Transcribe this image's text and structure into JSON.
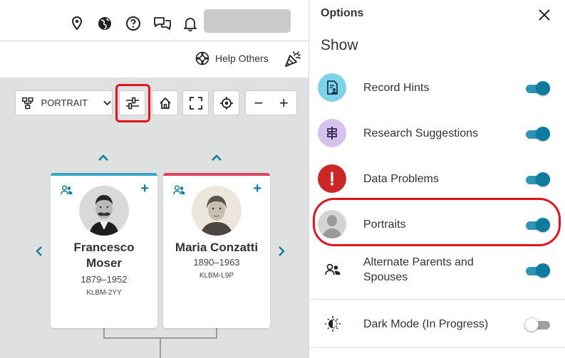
{
  "header": {
    "icons": [
      "location-pin-icon",
      "globe-icon",
      "help-circle-icon",
      "chat-icon",
      "bell-icon"
    ],
    "help_others_label": "Help Others"
  },
  "toolbar": {
    "view_label": "PORTRAIT",
    "zoom_out": "−",
    "zoom_in": "+"
  },
  "cards": [
    {
      "name_line1": "Francesco",
      "name_line2": "Moser",
      "dates": "1879–1952",
      "pid": "KLBM-2YY",
      "gender_color": "#3aa3c7"
    },
    {
      "name_line1": "Maria Conzatti",
      "name_line2": "",
      "dates": "1890–1963",
      "pid": "KLBM-L9P",
      "gender_color": "#d9455e"
    }
  ],
  "panel": {
    "title": "Options",
    "section": "Show",
    "options": [
      {
        "label": "Record Hints",
        "on": true,
        "badge_color": "#7fd3e8"
      },
      {
        "label": "Research Suggestions",
        "on": true,
        "badge_color": "#d7c2ee"
      },
      {
        "label": "Data Problems",
        "on": true,
        "badge_color": "#cc2727"
      },
      {
        "label": "Portraits",
        "on": true,
        "badge_color": "#d4d4d4"
      },
      {
        "label": "Alternate Parents and Spouses",
        "on": true
      },
      {
        "label": "Dark Mode (In Progress)",
        "on": false
      }
    ]
  },
  "colors": {
    "accent": "#0f7b9e",
    "highlight": "#e0141e",
    "canvas": "#dfe0e0"
  }
}
